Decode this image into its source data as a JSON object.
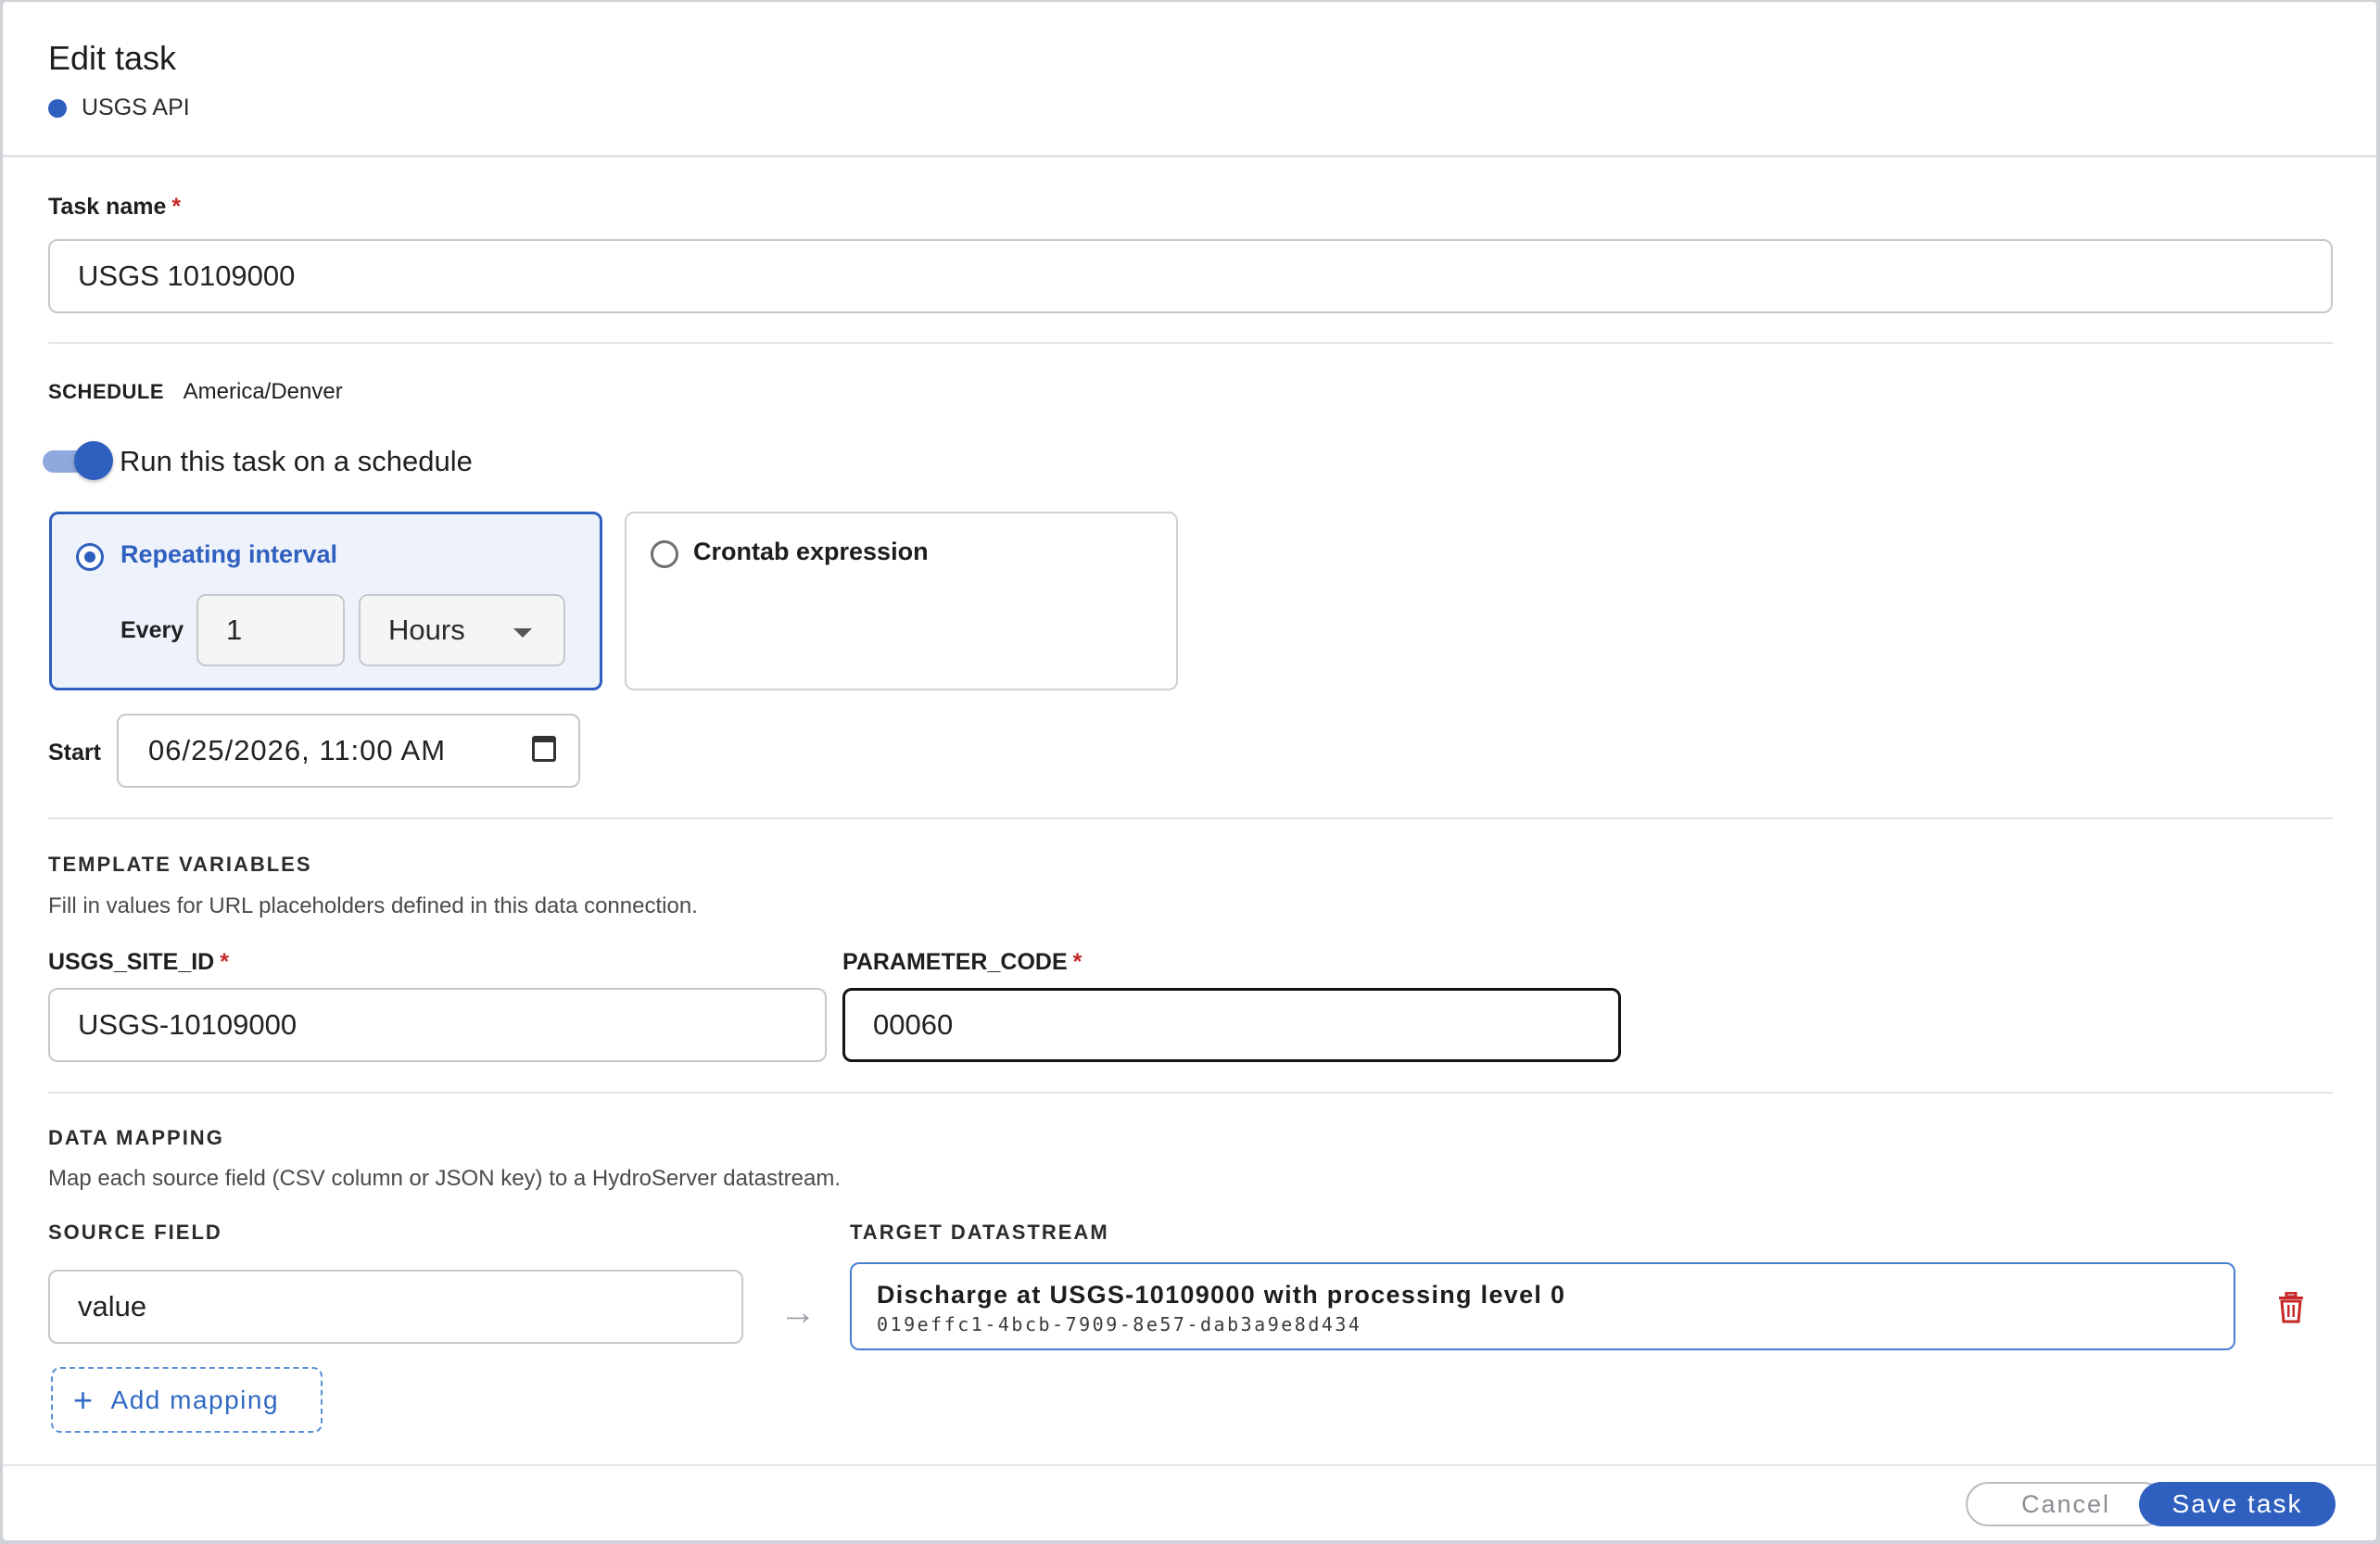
{
  "dialog": {
    "title": "Edit task",
    "connection_name": "USGS API",
    "connection_color": "#2f5fbf"
  },
  "task_name": {
    "label": "Task name",
    "required_mark": "*",
    "value": "USGS 10109000"
  },
  "schedule": {
    "heading": "SCHEDULE",
    "timezone": "America/Denver",
    "toggle_label": "Run this task on a schedule",
    "toggle_on": true,
    "options": {
      "repeating": {
        "label": "Repeating interval",
        "selected": true,
        "every_label": "Every",
        "every_value": "1",
        "unit_value": "Hours"
      },
      "crontab": {
        "label": "Crontab expression",
        "selected": false
      }
    },
    "start_label": "Start",
    "start_value": "06/25/2026, 11:00 AM"
  },
  "template_variables": {
    "heading": "TEMPLATE VARIABLES",
    "description": "Fill in values for URL placeholders defined in this data connection.",
    "fields": [
      {
        "label": "USGS_SITE_ID",
        "required_mark": "*",
        "value": "USGS-10109000"
      },
      {
        "label": "PARAMETER_CODE",
        "required_mark": "*",
        "value": "00060"
      }
    ]
  },
  "data_mapping": {
    "heading": "DATA MAPPING",
    "description": "Map each source field (CSV column or JSON key) to a HydroServer datastream.",
    "source_header": "SOURCE FIELD",
    "target_header": "TARGET DATASTREAM",
    "rows": [
      {
        "source": "value",
        "arrow": "→",
        "target_name": "Discharge at USGS-10109000 with processing level 0",
        "target_id": "019effc1-4bcb-7909-8e57-dab3a9e8d434"
      }
    ],
    "add_label": "Add mapping",
    "add_icon": "+"
  },
  "footer": {
    "cancel_label": "Cancel",
    "save_label": "Save task"
  },
  "colors": {
    "accent": "#2f5fbf",
    "danger": "#c62828"
  }
}
